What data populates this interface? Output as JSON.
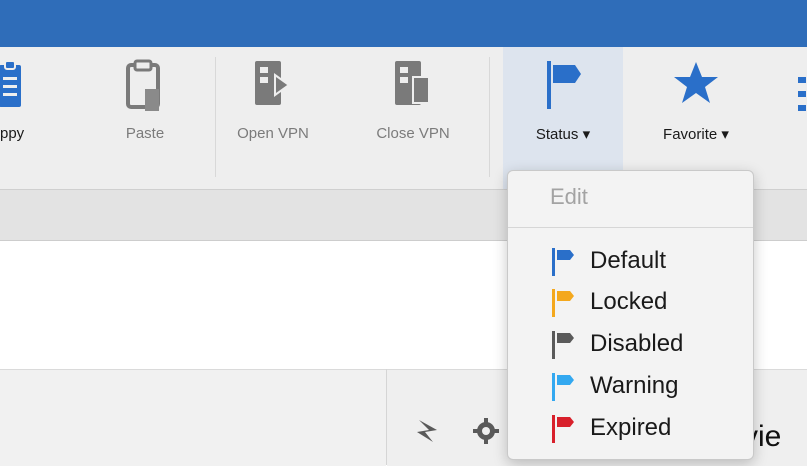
{
  "toolbar": {
    "copy_label": "ppy",
    "paste_label": "Paste",
    "open_vpn_label": "Open VPN",
    "close_vpn_label": "Close VPN",
    "status_label": "Status ▾",
    "favorite_label": "Favorite ▾"
  },
  "status_menu": {
    "edit_label": "Edit",
    "items": [
      {
        "label": "Default",
        "color": "#2a6fc9"
      },
      {
        "label": "Locked",
        "color": "#f4a81d"
      },
      {
        "label": "Disabled",
        "color": "#5a5a5a"
      },
      {
        "label": "Warning",
        "color": "#33a8f0"
      },
      {
        "label": "Expired",
        "color": "#d8202b"
      }
    ]
  },
  "panel": {
    "overview_partial": "rvie"
  },
  "colors": {
    "titlebar": "#2f6db9",
    "accent": "#2a6fc9"
  }
}
